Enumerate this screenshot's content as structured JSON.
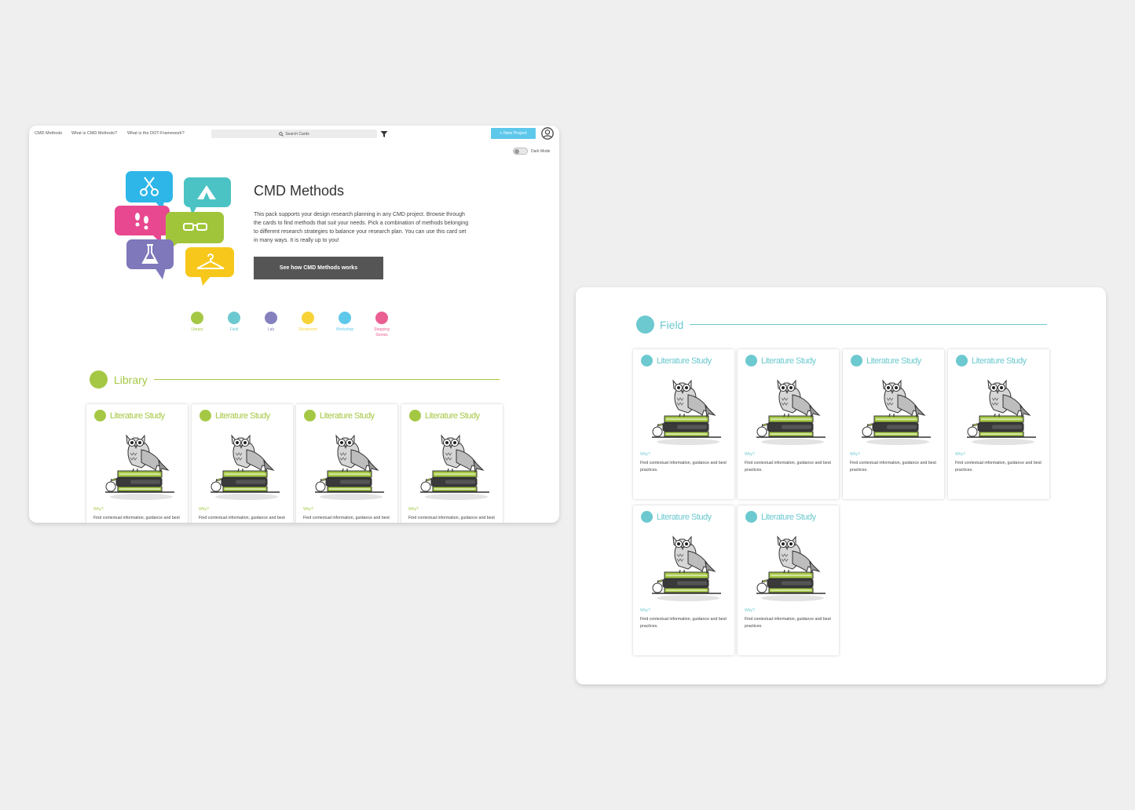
{
  "colors": {
    "library": "#a5c844",
    "field": "#6cc9d0",
    "lab": "#8581bf",
    "showroom": "#f7d338",
    "workshop": "#5ec8eb",
    "stepping_stones": "#ea5f92"
  },
  "nav": {
    "links": [
      "CMD Methods",
      "What is CMD Methods?",
      "What is the DOT-Framework?"
    ],
    "search_placeholder": "Search Cards",
    "new_project": "+ New Project",
    "dark_mode": "Dark Mode"
  },
  "hero": {
    "title": "CMD Methods",
    "description": "This pack supports your design research planning in any CMD project. Browse through the cards to find methods that suit your needs. Pick a combination of methods belonging to different research strategies to balance your research plan. You can use this card set in many ways. It is really up to you!",
    "button": "See how CMD Methods works",
    "icons": [
      "scissors-icon",
      "tent-icon",
      "footprints-icon",
      "glasses-icon",
      "flask-icon",
      "hanger-icon"
    ]
  },
  "categories": [
    {
      "label": "Library",
      "color": "#a5c844"
    },
    {
      "label": "Field",
      "color": "#6cc9d0"
    },
    {
      "label": "Lab",
      "color": "#8581bf"
    },
    {
      "label": "Showroom",
      "color": "#f7d338"
    },
    {
      "label": "Workshop",
      "color": "#5ec8eb"
    },
    {
      "label": "Stepping Stones",
      "color": "#ea5f92"
    }
  ],
  "library_section": {
    "title": "Library",
    "cards": [
      {
        "title": "Literature Study",
        "why": "Why?",
        "desc": "Find contextual information, guidance and best practices."
      },
      {
        "title": "Literature Study",
        "why": "Why?",
        "desc": "Find contextual information, guidance and best practices."
      },
      {
        "title": "Literature Study",
        "why": "Why?",
        "desc": "Find contextual information, guidance and best practices."
      },
      {
        "title": "Literature Study",
        "why": "Why?",
        "desc": "Find contextual information, guidance and best practices."
      }
    ]
  },
  "field_section": {
    "title": "Field",
    "cards": [
      {
        "title": "Literature Study",
        "why": "Why?",
        "desc": "Find contextual information, guidance and best practices."
      },
      {
        "title": "Literature Study",
        "why": "Why?",
        "desc": "Find contextual information, guidance and best practices."
      },
      {
        "title": "Literature Study",
        "why": "Why?",
        "desc": "Find contextual information, guidance and best practices."
      },
      {
        "title": "Literature Study",
        "why": "Why?",
        "desc": "Find contextual information, guidance and best practices."
      },
      {
        "title": "Literature Study",
        "why": "Why?",
        "desc": "Find contextual information, guidance and best practices."
      },
      {
        "title": "Literature Study",
        "why": "Why?",
        "desc": "Find contextual information, guidance and best practices."
      }
    ]
  }
}
